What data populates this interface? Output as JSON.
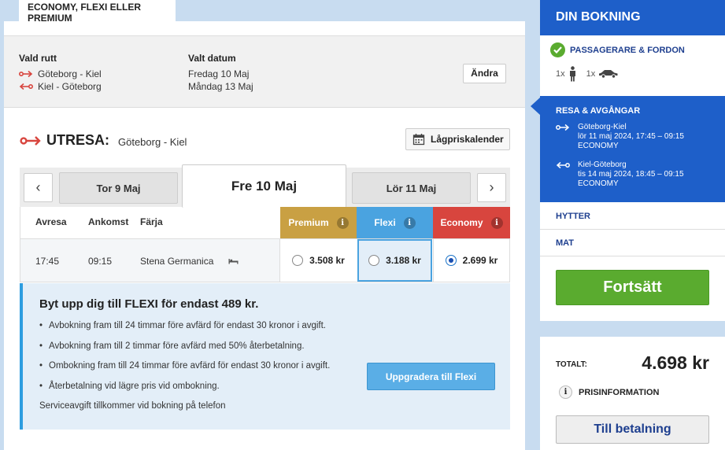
{
  "top_tab": "ECONOMY, FLEXI ELLER PREMIUM",
  "route_box": {
    "vald_rutt_label": "Vald rutt",
    "routes": [
      "Göteborg - Kiel",
      "Kiel - Göteborg"
    ],
    "valt_datum_label": "Valt datum",
    "dates": [
      "Fredag 10 Maj",
      "Måndag 13 Maj"
    ],
    "change_button": "Ändra"
  },
  "utresa": {
    "title": "UTRESA:",
    "route": "Göteborg - Kiel",
    "calendar_button": "Lågpriskalender"
  },
  "date_tabs": {
    "prev": "Tor 9 Maj",
    "active": "Fre 10 Maj",
    "next": "Lör 11 Maj"
  },
  "table": {
    "headers": {
      "avresa": "Avresa",
      "ankomst": "Ankomst",
      "farja": "Färja"
    },
    "row": {
      "avresa": "17:45",
      "ankomst": "09:15",
      "farja": "Stena Germanica"
    },
    "fares": [
      {
        "name": "Premium",
        "price": "3.508 kr",
        "color": "#c9a043",
        "selected": false
      },
      {
        "name": "Flexi",
        "price": "3.188 kr",
        "color": "#4aa3e0",
        "selected": false
      },
      {
        "name": "Economy",
        "price": "2.699 kr",
        "color": "#d8453e",
        "selected": true
      }
    ]
  },
  "upgrade": {
    "title": "Byt upp dig till FLEXI för endast 489 kr.",
    "items": [
      "Avbokning fram till 24 timmar före avfärd för endast 30 kronor i avgift.",
      "Avbokning fram till 2 timmar före avfärd med 50% återbetalning.",
      "Ombokning fram till 24 timmar före avfärd för endast 30 kronor i avgift.",
      "Återbetalning vid lägre pris vid ombokning."
    ],
    "note": "Serviceavgift tillkommer vid bokning på telefon",
    "button": "Uppgradera till Flexi"
  },
  "sidebar": {
    "title": "DIN BOKNING",
    "passengers_label": "PASSAGERARE & FORDON",
    "pax_count": "1x",
    "vehicle_count": "1x",
    "resa_title": "RESA & AVGÅNGAR",
    "legs": [
      {
        "route": "Göteborg-Kiel",
        "time": "lör 11 maj 2024, 17:45 – 09:15",
        "class": "ECONOMY"
      },
      {
        "route": "Kiel-Göteborg",
        "time": "tis 14 maj 2024, 18:45 – 09:15",
        "class": "ECONOMY"
      }
    ],
    "hytter": "HYTTER",
    "mat": "MAT",
    "continue_button": "Fortsätt",
    "total_label": "TOTALT:",
    "total_value": "4.698 kr",
    "prisinformation": "PRISINFORMATION",
    "pay_button": "Till betalning"
  },
  "colors": {
    "brand_blue": "#1e5fc9",
    "green": "#5aab2f",
    "red_arrow": "#d8453e"
  }
}
